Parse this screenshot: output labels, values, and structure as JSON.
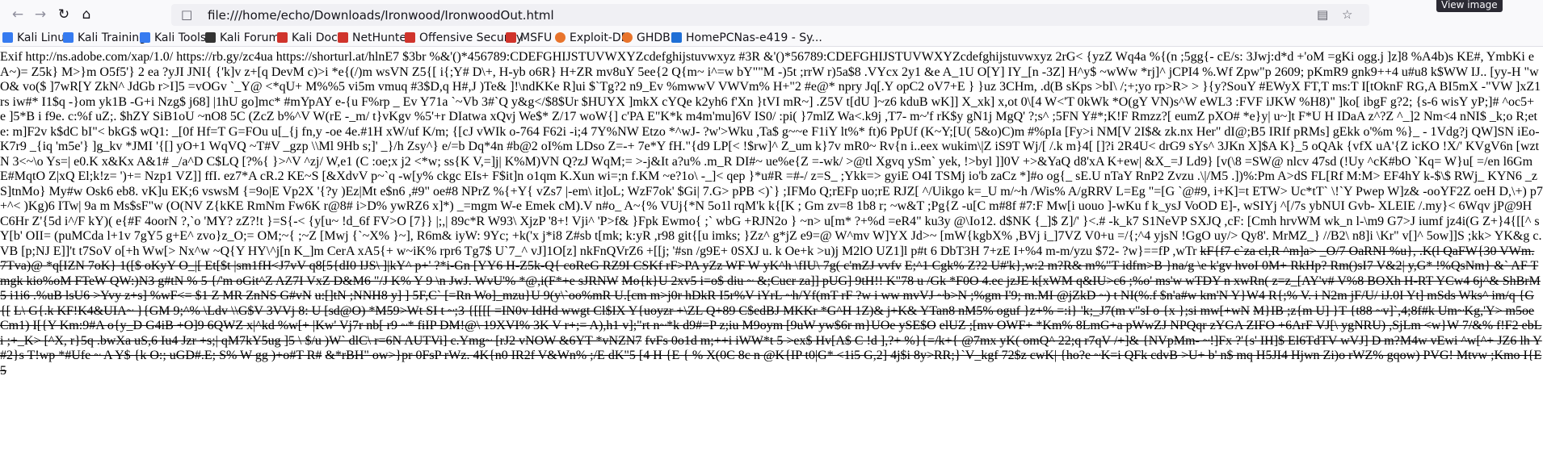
{
  "browser": {
    "url": "file:///home/echo/Downloads/Ironwood/IronwoodOut.html",
    "tooltip": "View image",
    "back_icon": "back-arrow-icon",
    "forward_icon": "forward-arrow-icon",
    "reload_icon": "reload-icon",
    "home_icon": "home-icon"
  },
  "bookmarks": [
    {
      "label": "Kali Linux",
      "icon": "kali-dragon-icon",
      "color": "#367bf0"
    },
    {
      "label": "Kali Training",
      "icon": "kali-dragon-icon",
      "color": "#367bf0"
    },
    {
      "label": "Kali Tools",
      "icon": "kali-dragon-icon",
      "color": "#367bf0"
    },
    {
      "label": "Kali Forums",
      "icon": "kali-forums-icon",
      "color": "#333333"
    },
    {
      "label": "Kali Docs",
      "icon": "kali-docs-icon",
      "color": "#d0342c"
    },
    {
      "label": "NetHunter",
      "icon": "nethunter-icon",
      "color": "#d0342c"
    },
    {
      "label": "Offensive Security",
      "icon": "offsec-icon",
      "color": "#d0342c"
    },
    {
      "label": "MSFU",
      "icon": "msfu-icon",
      "color": "#d0342c"
    },
    {
      "label": "Exploit-DB",
      "icon": "exploitdb-icon",
      "color": "#e8742c"
    },
    {
      "label": "GHDB",
      "icon": "ghdb-icon",
      "color": "#e8742c"
    },
    {
      "label": "HomePCNas-e419 - Sy...",
      "icon": "synology-icon",
      "color": "#1f6fd6"
    }
  ],
  "content": {
    "lines": [
      "Exif http://ns.adobe.com/xap/1.0/ https://rb.gy/zc4ua https://shorturl.at/hlnE7 $3br %&'()*456789:CDEFGHIJSTUVWXYZcdefghijstuvwxyz #3R &'()*56789:CDEFGHIJSTUVWXYZcdefghijstuvwxyz 2rG< {yzZ Wq4a %{(n ;5gg{- cE/s:",
      "3Jwj:d*d +'oM =gKi ogg.j ]z]8 %A4b)s KE#, YmbKi eA~)= Z5k} M>}m O5f5'} 2 ea ?yJI JNI{ {'k]v z+[q DevM c)>i *e{(/)m wsVN Z5{[ i{;Y# D\\+, H-yb o6R} H+ZR mv8uY 5ee{2 Q{m~ i^=w bY\"\"M -)5t ;rrW r)5a$8 .VYcx 2y1 &e",
      "A_1U O[Y] IY_[n -3Z] H^y$ ~wWw *rj]^ jCPI4 %.Wf Zpw\"p 2609; pKmR9 gnk9++4 u#u8 k$WW IJ.. [yy-H \"wO& vo($ ]7wR[Y ZkN^ JdGb r>I]5 =vOGv `_Y@ <*qU+ M%%5 vi5m vmuq #3$D,q H#,J )Te& ]!\\ndKKe R]ui $`Tg?2 n9_Ev",
      "%mwwV VWVm% H+\"2 #e@* npry Jq[.Y opC2 oV7+E } }uz 3CHm, .d(B sKps >bI\\ /;+;yo rp>R> > }{y?SouY #EWyX FT,T ms:T I[tOknF RG,A BI5mX -\"VW ]xZ1rs iw#* I1$q -}om yk1B -G+i Nzg$ j68] |1hU go]mc* #mYpAY e-{u F%rp",
      "_ Ev Y71a `~Vb 3#`Q y&g</$8$Ur $HUYX ]mkX cYQe k2yh6 f'Xn }tVI mR~] .Z5V t[dU ]~z6 kduB wK]] X_xk] x,ot 0\\[4 W<'T 0kWk *O(gY VN)s^W eWL3 :FVF iJKW %H8)\" ]ko[ ibgF g?2; {s-6 wisY yP;]# ^oc5+ e ]5*B i f9e. c:%f uZ;.",
      "$hZY SiB1oU ~nO8 5C (ZcZ b%^V W(rE -_m/ t}vKgv %5'+r DIatwa xQvj We$* Z/17 woW{] c'PA E\"K*k m4m'mu]6V IS0/ :pi( }7mlZ Wa<.k9j ,T7- m~'f rK$y gN1j MgQ' ?;s^ ;5FN Y#*;K!F Rmzz?[ eumZ pXO# *e}y| u~]t F*U H IDaA",
      "z^?Z ^_]2 Nm<4 nNI$ _k;o R;ete: m]F2v k$dC bI\"< bkG$ wQ1: _[0f Hf=T G=FOu u[_{j fn,y -oe 4e.#1H xW/uf K/m; {[cJ vWIk o-764 F62i -i;4 7Y%NW Etzo *^wJ- ?w'>Wku ,Ta$ g~~e F1iY lt%* ft)6 PpUf (K~Y;[U( 5&o)C)m #%pIa",
      "[Fy>i NM[V 2I$& zk.nx Her\" dI@;B5 IRIf pRMs] gEkk o'%m %}_ - 1Vdg?j QW]SN iEo- K7r9 _{iq 'm5e'} ]g_kv *JMI '{[] yO+1 WqVQ ~T#V _gzp \\\\Ml 9Hb s;]' _}/h Zsy^} e/=b Dq*4n #b@2 oI%m LDso Z=-+ 7e*Y fH.\"{d9 LP[< !$rw]^",
      "Z_um k}7v mR0~ Rv{n i..eex wukim\\|Z iS9T Wj/[ /.k m}4[ []?i 2R4U< drG9 sYs^ 3JKn X]$A K}_5 oQAk {vfX uA'{Z icKO !X/' KVgV6n [wztN 3<~\\o Ys=| e0.K x&Kx A&1# _/a^D C$LQ [?%{ }>^V ^zj/ W,e1 (C :oe;x j2 <*w; ss{K V,=]j|",
      "K%M)VN Q?zJ WqM;= >-j&It a?u% .m_R DI#~ ue%e{Z =-wk/ >@tl Xgvq ySm` yek, !>byl ]]0V +>&YaQ d8'xA K+ew| &X_=J Ld9} [v(\\8 =SW@ nlcv 47sd (!Uy ^cK#bO `Kq= W}u[ =/en l6Gm E#MqtO Z|xQ El;k!z= ')+= Nzp1 VZ]] ffI.",
      "ez7*A cR.2 KE~S [&XdvV p~`q -w[y% ckgc EIs+ F$it]n o1qm K.Xun wi=;n f.KM ~e?1o\\ -_]< qep }*u#R =#-/ z=S_ ;Ykk=> gyiE O4I TSMj io'b zaCz *]#o og{_ sE.U nTaY RnP2 Zvzu .\\|/M5 .])%:Pm A>dS FL[Rf M:M> EF4hY k-$\\$",
      "RWj_ KYN6 _zS]tnMo} My#w Osk6 eb8. vK]u EK;6 vswsM {=9o|E Vp2X '{?y )Ez|Mt e$n6 ,#9\" oe#8 NPrZ %{+Y{ vZs7 |-em\\ it]oL; WzF7ok' $Gi| 7.G> pPB <)`} ;IFMo Q;rEFp uo;rE RJZ[ ^/Uikgo k=_U m/~h /Wis% A/gRRV L=Eg",
      "\"=[G `@#9, i+K]=t ETW> Uc*tT` \\!`Y Pwep W]z& -ooYF2Z oeH D,\\+) p7+^< )Kg)6 ITw| 9a m Ms$sF\"w (O(NV Z{kKE RmNm Fw6K r@8# i>D% ywRZ6 x]*) _=mgm W-e Emek cM).V n#o_ A~{% VUj{*N 5o1l rqM'k k{[K ; Gm zv=8",
      "1b8 r; ~w&T ;Pg{Z -u[C m#8f #7:F Mw[i uouo ]-wKu f k_ysJ VoOD E]-, wSIYj ^[/7s ybNUI Gvb- XLEIE /.my}< 6Wqv jP@9H C6Hr Z'{5d i^/F kY)( e{#F 4oorN ?,`o 'MY? zZ?!t }=S{-< {y[u~ !d_6f FV>O [7}} |;,| 89c*R W93\\ XjzP '8+!",
      "Vji^ 'P>f& }Fpk Ewmo{ ;` wbG +RJN2o } ~n> u[m* ?+%d =eR4\" ku3y @\\Io12. d$NK {_]$ Z]/' }<.# -k_k7 S1NeVP SXJQ ,cF: [Cmh hrvWM wk_n l-\\m9 G7>J iumf jz4i(G Z+}4{[[^ sY[b' OII= (puMCda l+1v 7gY5 g+E^ zvo}z_O;=",
      "OM;~{ ;~Z [Mwj {`~X% }~], R6m& iyW: 9Yc; +k('x j*i8 Z#sb t[mk; k:yR ,r98 git{[u imks; }Zz^ g*jZ e9=@ W^mv W]YX Jd>~ [mW{kgbX% ,BVj i_]7VZ V0+u =/{;^4 yjsN !GgO uy/> Qy8'. MrMZ_} //B2\\ n8]i \\Kr\" v[]^ 5ow]]S ;kk>",
      "YK&g c.VB [p;NJ E]]'t t7SoV o[+h Ww[> Nx^w ~Q{Y HY\\^j[n K_]m CerA xA5{+ w~iK% rpr6 Tg7$ U`7_^ vJ]1O[z] nkFnQVrZ6 +[[j; '#sn /g9E+ 0SXJ u. k Oe+k >u)j M2lO UZ1]l p#t 6 DbT3H 7+zE I+%4 m-m/yzu $72- ?w}==fP ,wTr"
    ],
    "strike_lines": [
      "kF{f7 c`za cl,R ^m]a> _O/7 OaRNI %u}, .K(l QaFW{30 VWm. 7Tva)@ *q[IZN 7oK} 1([$ oKyY O_|[ Et[$t |sm1fH<J7vV q8[5{dI0 IJS\\ ]|kY^ p+' ?*i-Gn [YY6 H-Z5k-Q{ coReG RZ9I CSKf rF>PA yZz WF W yK^h \\fIU\\ 7g( c'mZJ vvfv",
      "E;^1 Cgk% Z?2 U#'k},w:2 m?R& m%\"T idfm>B }na/g \\e k'gv hvoI 0M+ RkHp? Rm()sI7 V&2| y,G* !%QsNm} &` AF Tmgk kio%oM FTeW QW:)N3 g#tN % 5 {/'m oGit^Z AZ7I VxZ D&M6 \"/J K% Y 9 \\n JwJ. WvU'% *@,i(F*+e sJRNW",
      "Mo{k}U 2xv5 i=o$ diu ~ &;Cucr za]] pUG] 9tH!! K\"78 u /Gk *F0O 4.ec jzJE k[xWM q&IU>c6 ;%o' ms'w wTDY n xwRn( z=z_[AY'v# V%8 BOXh H-RT YCw4 6j^& ShBrM5 i1i6 .%uB lsU6 >Yvy z+s] %wF<= $1 Z MR ZnNS G#vN",
      "u:[]tN ;NNH8 y] ] 5F,C` [=Rn Wo]_mzu}U 9(y\\`oo%mR U.[cm m>j0r hDkR I5r%V iYrL ~h/Yf(mT rF ?w i ww mvVJ ~b>N ;%gm I'9; m.MI @jZkD ~) t NI(%.f $n'a#w km'N Y}W4 R{;% V. i N2m jF/U/ iJ.0I Yt] mSds Wks^ im/q {G{[",
      "L\\ G{.k KF!K4&UIA~ }{GM 9;^% \\Ldv \\\\G$V 3VVj 8: U [sd@O) *M59>Wt SI t ~;3 {[[[[ =IN0v IdHd wwgt Cl$IX Y{uoyzr +\\ZL Q+89 C$edBJ MKKr *G^H 1Z)& j+K& YTan8 nM5% oguf }z+% =:i} 'k;_J7(m v\"sI o {x };si mw[+wN",
      "M}IB ;z{m U] }T {t88 ~v]`,4;8f#k Um~Kg,'Y> m5oe Cm1) I[{Y Km:9#A o{y_D G4iB +O]9 6QWZ x|^kd %w[+ |Kw' Vj7r nb[ r9 ~* fiIP DM!@\\ 19XVI% 3K V r+;= A),h1 v];\"rt n~*k d9#=P z;iu M9oym [9uW yw$6r m}UOe ySE$O",
      "elUZ ;[mv OWF+ *Km% 8LmG+a pWwZJ NPQqr zYGA ZIFO +6ArF VJ[\\ ygNRU) ,SjLm <w}W 7/&% f!F2 ebLi ;+_K> [^X, r}5q .bwXa uS,6 Iu4 Jzr +s;| qM7kY5ug ]5 \\ $/u )W` dlC\\ r=6N AUTVi] c.Ymg~ [rJ2 vNOW &6YT *vNZN7",
      "fvFs 0o1d m;++i iWW*t 5 >ex$ Hv[A$ C !d ],?+ %}{=/k+{ @7mx yK( omQ^ 22;q r7qV /+]& {NVpMm- ~!]Fx ?'{s' IH]$ El6TdTV wVJ] D m?M4w vEwi ^w[^+ JZ6 lh Y#2}s T!wp *#Ufe ~ A Y$ {k O:; uGD#.E; S% W gg )+o#T R#",
      "&*rBH\" ow>}pr 0FsP rWz. 4K{n0 IR2f V&Wn% ;/E dK\"5 [4 H {E { % X(0C 8c n @K{IP t0|G* <1i5 G,2] 4j$i 8y>RR;}`V_kgf 72$z cwK| {ho?e ~K=i QFk cdvB >U+ b' n$ mq H5JI4 Hjwn Zi)o rWZ% gqow) PVG! Mtvw ;Kmo I{E5"
    ]
  }
}
